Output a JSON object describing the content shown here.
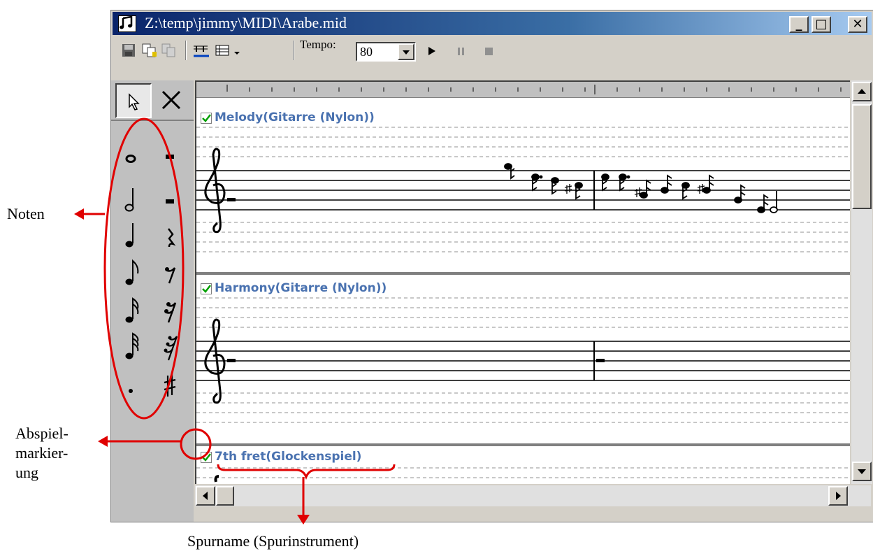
{
  "window": {
    "title": "Z:\\temp\\jimmy\\MIDI\\Arabe.mid",
    "minimize_label": "_",
    "maximize_label": "□",
    "close_label": "✕"
  },
  "toolbar": {
    "tempo_label": "Tempo:",
    "tempo_value": "80",
    "icons": [
      "save-icon",
      "copy-icon",
      "paste-icon",
      "staff-icon",
      "list-icon",
      "dropdown-icon",
      "play-icon",
      "pause-icon",
      "stop-icon"
    ]
  },
  "palette": {
    "tools": [
      "pointer-icon",
      "delete-icon"
    ],
    "notes": [
      "whole-note",
      "half-note",
      "quarter-note",
      "eighth-note",
      "sixteenth-note",
      "thirty-second-note",
      "dot"
    ],
    "rests": [
      "whole-rest",
      "half-rest",
      "quarter-rest",
      "eighth-rest",
      "sixteenth-rest",
      "thirty-second-rest",
      "sharp"
    ]
  },
  "tracks": [
    {
      "name": "Melody(Gitarre (Nylon))",
      "checked": true
    },
    {
      "name": "Harmony(Gitarre (Nylon))",
      "checked": true
    },
    {
      "name": "7th fret(Glockenspiel)",
      "checked": true
    }
  ],
  "annotations": {
    "noten": "Noten",
    "abspiel_line1": "Abspiel-",
    "abspiel_line2": "markier-",
    "abspiel_line3": "ung",
    "spurname": "Spurname (Spurinstrument)"
  },
  "colors": {
    "annotation": "#e00000",
    "track_name": "#4a72b0",
    "checkmark": "#00a000"
  }
}
